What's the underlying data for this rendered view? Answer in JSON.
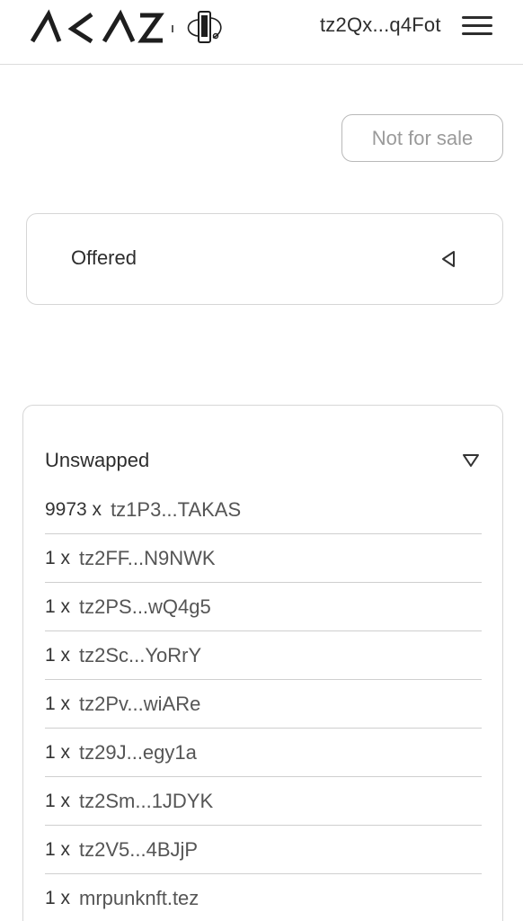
{
  "header": {
    "logo_text": "AKAS",
    "wallet_address": "tz2Qx...q4Fot",
    "menu_icon": "hamburger-menu-icon"
  },
  "sale_button": {
    "label": "Not for sale"
  },
  "offered": {
    "label": "Offered",
    "icon": "triangle-left-icon"
  },
  "unswapped": {
    "title": "Unswapped",
    "icon": "triangle-down-icon",
    "holders": [
      {
        "qty": "9973 x",
        "address": "tz1P3...TAKAS"
      },
      {
        "qty": "1 x",
        "address": "tz2FF...N9NWK"
      },
      {
        "qty": "1 x",
        "address": "tz2PS...wQ4g5"
      },
      {
        "qty": "1 x",
        "address": "tz2Sc...YoRrY"
      },
      {
        "qty": "1 x",
        "address": "tz2Pv...wiARe"
      },
      {
        "qty": "1 x",
        "address": "tz29J...egy1a"
      },
      {
        "qty": "1 x",
        "address": "tz2Sm...1JDYK"
      },
      {
        "qty": "1 x",
        "address": "tz2V5...4BJjP"
      },
      {
        "qty": "1 x",
        "address": "mrpunknft.tez"
      }
    ]
  }
}
